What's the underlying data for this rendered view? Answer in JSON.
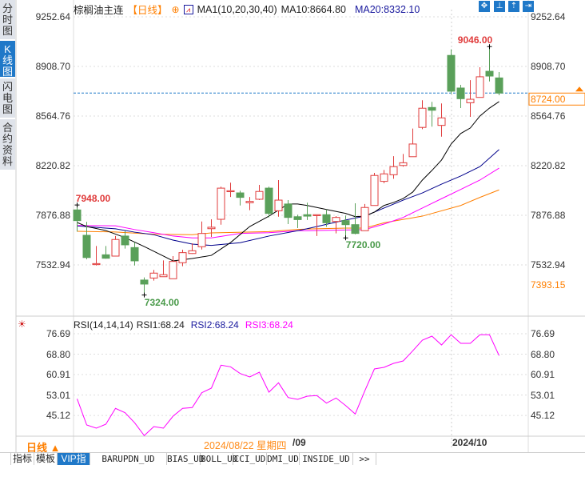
{
  "side_tabs": [
    {
      "label": "分时图"
    },
    {
      "label": "K线图",
      "selected": true
    },
    {
      "label": "闪电图"
    },
    {
      "label": "合约资料"
    }
  ],
  "header": {
    "title": "棕榈油主连",
    "period": "【日线】",
    "indicator": "MA1(10,20,30,40)",
    "ma10": "MA10:8664.80",
    "ma20": "MA20:8332.10"
  },
  "toolbar_icons": [
    "crosshair-icon",
    "range-icon",
    "zoom-in-icon",
    "exit-icon"
  ],
  "price_axis": {
    "labels": [
      "9252.64",
      "8908.70",
      "8564.76",
      "8220.82",
      "7876.88",
      "7532.94"
    ],
    "values": [
      9252.64,
      8908.7,
      8564.76,
      8220.82,
      7876.88,
      7532.94
    ]
  },
  "last_price": {
    "label": "8724.00",
    "value": 8724.0
  },
  "low_marker": {
    "label": "7393.15",
    "value": 7393.15
  },
  "extremes": [
    {
      "label": "7948.00",
      "index": 0,
      "value": 7948,
      "color": "#e03c3c"
    },
    {
      "label": "7324.00",
      "index": 7,
      "value": 7324,
      "color": "#4a9a4a"
    },
    {
      "label": "7720.00",
      "index": 28,
      "value": 7720,
      "color": "#4a9a4a"
    },
    {
      "label": "9046.00",
      "index": 43,
      "value": 9046,
      "color": "#e03c3c"
    }
  ],
  "colors": {
    "up": "#e03c3c",
    "down": "#5aa05a",
    "ma10": "#000000",
    "ma20": "#00008b",
    "ma30": "#ff00ff",
    "ma40": "#ff7f00",
    "rsi": "#ff00ff",
    "accent": "#1f78c8",
    "orange": "#ff7f00"
  },
  "candles": [
    [
      7914,
      7840,
      7948,
      7764
    ],
    [
      7738,
      7584,
      7831,
      7572
    ],
    [
      7535,
      7542,
      7664,
      7529
    ],
    [
      7603,
      7579,
      7664,
      7576
    ],
    [
      7594,
      7709,
      7733,
      7594
    ],
    [
      7733,
      7672,
      7770,
      7646
    ],
    [
      7653,
      7561,
      7690,
      7529
    ],
    [
      7428,
      7400,
      7446,
      7324
    ],
    [
      7442,
      7476,
      7498,
      7424
    ],
    [
      7451,
      7465,
      7564,
      7450
    ],
    [
      7437,
      7557,
      7594,
      7437
    ],
    [
      7548,
      7618,
      7638,
      7524
    ],
    [
      7612,
      7631,
      7683,
      7609
    ],
    [
      7659,
      7751,
      7834,
      7640
    ],
    [
      7784,
      7794,
      7849,
      7727
    ],
    [
      7849,
      8065,
      8075,
      7812
    ],
    [
      8042,
      8047,
      8103,
      8004
    ],
    [
      8032,
      8001,
      8047,
      7945
    ],
    [
      7964,
      7973,
      8004,
      7912
    ],
    [
      7988,
      8042,
      8088,
      7982
    ],
    [
      8065,
      7890,
      8075,
      7862
    ],
    [
      7908,
      7982,
      8121,
      7867
    ],
    [
      7955,
      7862,
      7982,
      7816
    ],
    [
      7867,
      7847,
      7881,
      7788
    ],
    [
      7881,
      7871,
      7964,
      7844
    ],
    [
      7877,
      7881,
      7882,
      7733
    ],
    [
      7881,
      7825,
      7917,
      7797
    ],
    [
      7834,
      7862,
      7871,
      7751
    ],
    [
      7840,
      7812,
      7875,
      7720
    ],
    [
      7812,
      7751,
      7960,
      7745
    ],
    [
      7770,
      7931,
      7955,
      7770
    ],
    [
      7945,
      8153,
      8171,
      7945
    ],
    [
      8112,
      8164,
      8191,
      8099
    ],
    [
      8158,
      8214,
      8287,
      8130
    ],
    [
      8222,
      8241,
      8302,
      8214
    ],
    [
      8283,
      8371,
      8478,
      8283
    ],
    [
      8486,
      8619,
      8674,
      8474
    ],
    [
      8624,
      8605,
      8663,
      8491
    ],
    [
      8500,
      8552,
      8652,
      8422
    ],
    [
      8985,
      8737,
      9027,
      8718
    ],
    [
      8759,
      8685,
      8781,
      8620
    ],
    [
      8657,
      8681,
      8814,
      8559
    ],
    [
      8694,
      8837,
      8903,
      8694
    ],
    [
      8875,
      8842,
      9046,
      8805
    ],
    [
      8829,
      8724,
      8870,
      8709
    ]
  ],
  "ma_lines": {
    "ma10": [
      [
        0,
        7827
      ],
      [
        1,
        7799
      ],
      [
        3,
        7771
      ],
      [
        5,
        7722
      ],
      [
        7,
        7660
      ],
      [
        9,
        7594
      ],
      [
        10,
        7561
      ],
      [
        12,
        7577
      ],
      [
        14,
        7599
      ],
      [
        16,
        7688
      ],
      [
        18,
        7799
      ],
      [
        20,
        7871
      ],
      [
        22,
        7955
      ],
      [
        23,
        7955
      ],
      [
        24,
        7945
      ],
      [
        26,
        7917
      ],
      [
        28,
        7890
      ],
      [
        29,
        7867
      ],
      [
        30,
        7871
      ],
      [
        31,
        7899
      ],
      [
        32,
        7945
      ],
      [
        33,
        7966
      ],
      [
        34,
        7993
      ],
      [
        35,
        8038
      ],
      [
        36,
        8121
      ],
      [
        37,
        8188
      ],
      [
        38,
        8260
      ],
      [
        39,
        8371
      ],
      [
        40,
        8444
      ],
      [
        41,
        8482
      ],
      [
        42,
        8565
      ],
      [
        43,
        8620
      ],
      [
        44,
        8664.8
      ]
    ],
    "ma20": [
      [
        0,
        7803
      ],
      [
        4,
        7783
      ],
      [
        6,
        7760
      ],
      [
        8,
        7742
      ],
      [
        10,
        7705
      ],
      [
        12,
        7677
      ],
      [
        14,
        7668
      ],
      [
        17,
        7687
      ],
      [
        20,
        7733
      ],
      [
        23,
        7770
      ],
      [
        24,
        7784
      ],
      [
        28,
        7844
      ],
      [
        30,
        7871
      ],
      [
        32,
        7927
      ],
      [
        34,
        7982
      ],
      [
        36,
        8032
      ],
      [
        38,
        8093
      ],
      [
        40,
        8149
      ],
      [
        42,
        8214
      ],
      [
        44,
        8332.1
      ]
    ],
    "ma30": [
      [
        0,
        7806
      ],
      [
        4,
        7804
      ],
      [
        6,
        7778
      ],
      [
        8,
        7756
      ],
      [
        10,
        7733
      ],
      [
        12,
        7720
      ],
      [
        14,
        7720
      ],
      [
        17,
        7751
      ],
      [
        20,
        7756
      ],
      [
        23,
        7770
      ],
      [
        24,
        7770
      ],
      [
        28,
        7775
      ],
      [
        30,
        7778
      ],
      [
        32,
        7816
      ],
      [
        34,
        7862
      ],
      [
        36,
        7927
      ],
      [
        38,
        7992
      ],
      [
        40,
        8056
      ],
      [
        42,
        8121
      ],
      [
        44,
        8204
      ]
    ],
    "ma40": [
      [
        0,
        7766
      ],
      [
        4,
        7761
      ],
      [
        8,
        7746
      ],
      [
        12,
        7742
      ],
      [
        14,
        7755
      ],
      [
        20,
        7764
      ],
      [
        23,
        7779
      ],
      [
        24,
        7782
      ],
      [
        28,
        7788
      ],
      [
        30,
        7788
      ],
      [
        32,
        7825
      ],
      [
        36,
        7871
      ],
      [
        40,
        7945
      ],
      [
        42,
        8001
      ],
      [
        44,
        8053
      ]
    ]
  },
  "rsi": {
    "title": "RSI(14,14,14)",
    "rsi1": "RSI1:68.24",
    "rsi2": "RSI2:68.24",
    "rsi3": "RSI3:68.24",
    "axis_labels": [
      "76.69",
      "68.80",
      "60.91",
      "53.01",
      "45.12"
    ],
    "axis_values": [
      76.69,
      68.8,
      60.91,
      53.01,
      45.12
    ],
    "values": [
      51.56,
      41.45,
      40.21,
      41.76,
      47.85,
      46.18,
      42.28,
      37.34,
      40.83,
      40.21,
      44.85,
      47.85,
      48.16,
      53.91,
      55.67,
      64.54,
      63.92,
      61.33,
      60.0,
      61.85,
      54.12,
      57.74,
      52.05,
      51.34,
      52.58,
      52.8,
      49.89,
      51.87,
      48.96,
      45.69,
      54.65,
      63.09,
      63.71,
      65.25,
      66.18,
      70.11,
      74.22,
      75.76,
      72.36,
      76.29,
      72.98,
      72.98,
      76.29,
      76.29,
      68.24
    ]
  },
  "footer": {
    "period": "日线 ▲",
    "cursor_date": "2024/08/22 星期四",
    "month1": "/09",
    "month2": "2024/10"
  },
  "bottom_tabs": [
    {
      "label": "指标"
    },
    {
      "label": "模板"
    },
    {
      "label": "VIP指标",
      "selected": true
    },
    {
      "label": "BARUPDN_UD"
    },
    {
      "label": "BIAS_UD"
    },
    {
      "label": "BOLL_UD"
    },
    {
      "label": "CCI_UD"
    },
    {
      "label": "DMI_UD"
    },
    {
      "label": "INSIDE_UD"
    },
    {
      "label": ">>"
    }
  ]
}
